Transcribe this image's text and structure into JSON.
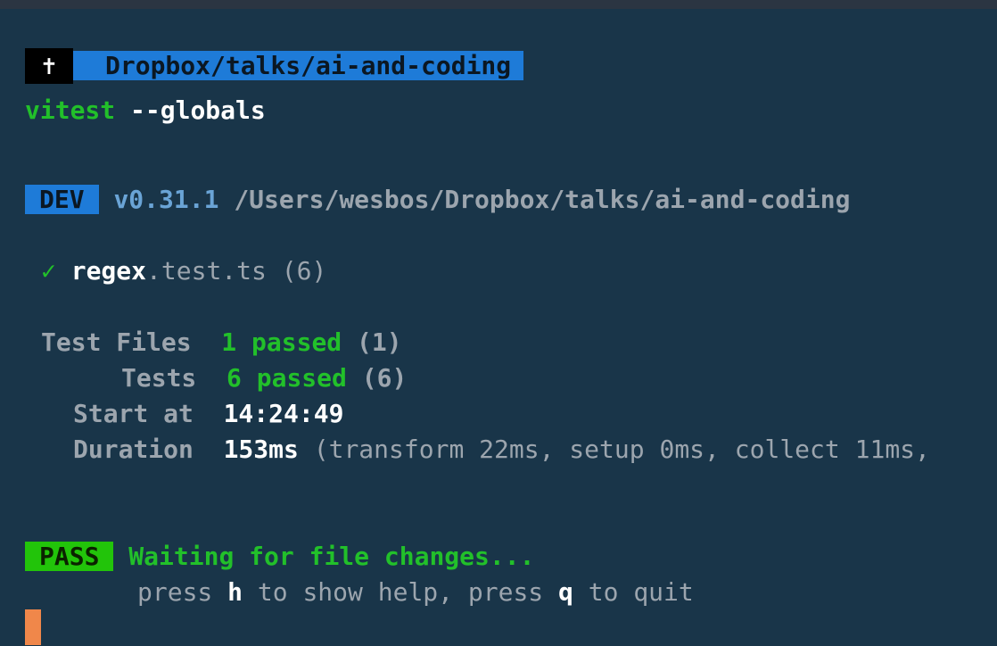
{
  "prompt": {
    "symbol": "✝",
    "path": "Dropbox/talks/ai-and-coding"
  },
  "command": {
    "name": "vitest",
    "args": "--globals"
  },
  "dev_banner": {
    "badge": "DEV",
    "version": "v0.31.1",
    "path": "/Users/wesbos/Dropbox/talks/ai-and-coding"
  },
  "test_file": {
    "check": "✓",
    "name": "regex",
    "ext": ".test.ts",
    "count": "(6)"
  },
  "summary": {
    "test_files_label": "Test Files",
    "test_files_passed": "1 passed",
    "test_files_total": "(1)",
    "tests_label": "Tests",
    "tests_passed": "6 passed",
    "tests_total": "(6)",
    "start_label": "Start at",
    "start_value": "14:24:49",
    "duration_label": "Duration",
    "duration_value": "153ms",
    "duration_detail": "(transform 22ms, setup 0ms, collect 11ms,"
  },
  "status": {
    "badge": "PASS",
    "message": "Waiting for file changes...",
    "help_prefix": "press ",
    "help_key_h": "h",
    "help_middle": " to show help, press ",
    "help_key_q": "q",
    "help_suffix": " to quit"
  },
  "colors": {
    "background": "#193549",
    "accent_blue": "#1e7bd8",
    "pass_green": "#22c40a",
    "cursor": "#f0874a"
  }
}
